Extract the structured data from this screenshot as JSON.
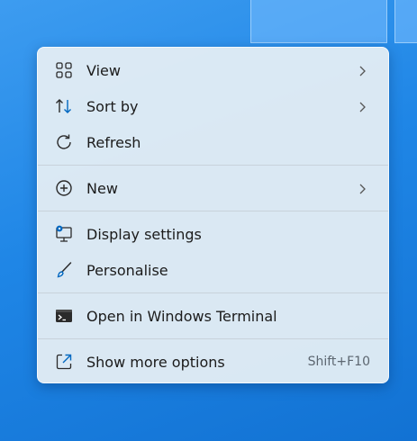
{
  "menu": {
    "items": [
      {
        "label": "View",
        "icon": "grid-icon",
        "submenu": true
      },
      {
        "label": "Sort by",
        "icon": "sort-arrows-icon",
        "submenu": true
      },
      {
        "label": "Refresh",
        "icon": "refresh-icon",
        "submenu": false
      },
      {
        "label": "New",
        "icon": "plus-circle-icon",
        "submenu": true
      },
      {
        "label": "Display settings",
        "icon": "monitor-settings-icon",
        "submenu": false
      },
      {
        "label": "Personalise",
        "icon": "brush-icon",
        "submenu": false
      },
      {
        "label": "Open in Windows Terminal",
        "icon": "terminal-icon",
        "submenu": false
      },
      {
        "label": "Show more options",
        "icon": "open-external-icon",
        "shortcut": "Shift+F10",
        "submenu": false
      }
    ]
  },
  "colors": {
    "desktop": "#1f86e6",
    "menu_background": "#e2ecf4",
    "accent": "#0067c0",
    "text": "#1b1b1b"
  }
}
